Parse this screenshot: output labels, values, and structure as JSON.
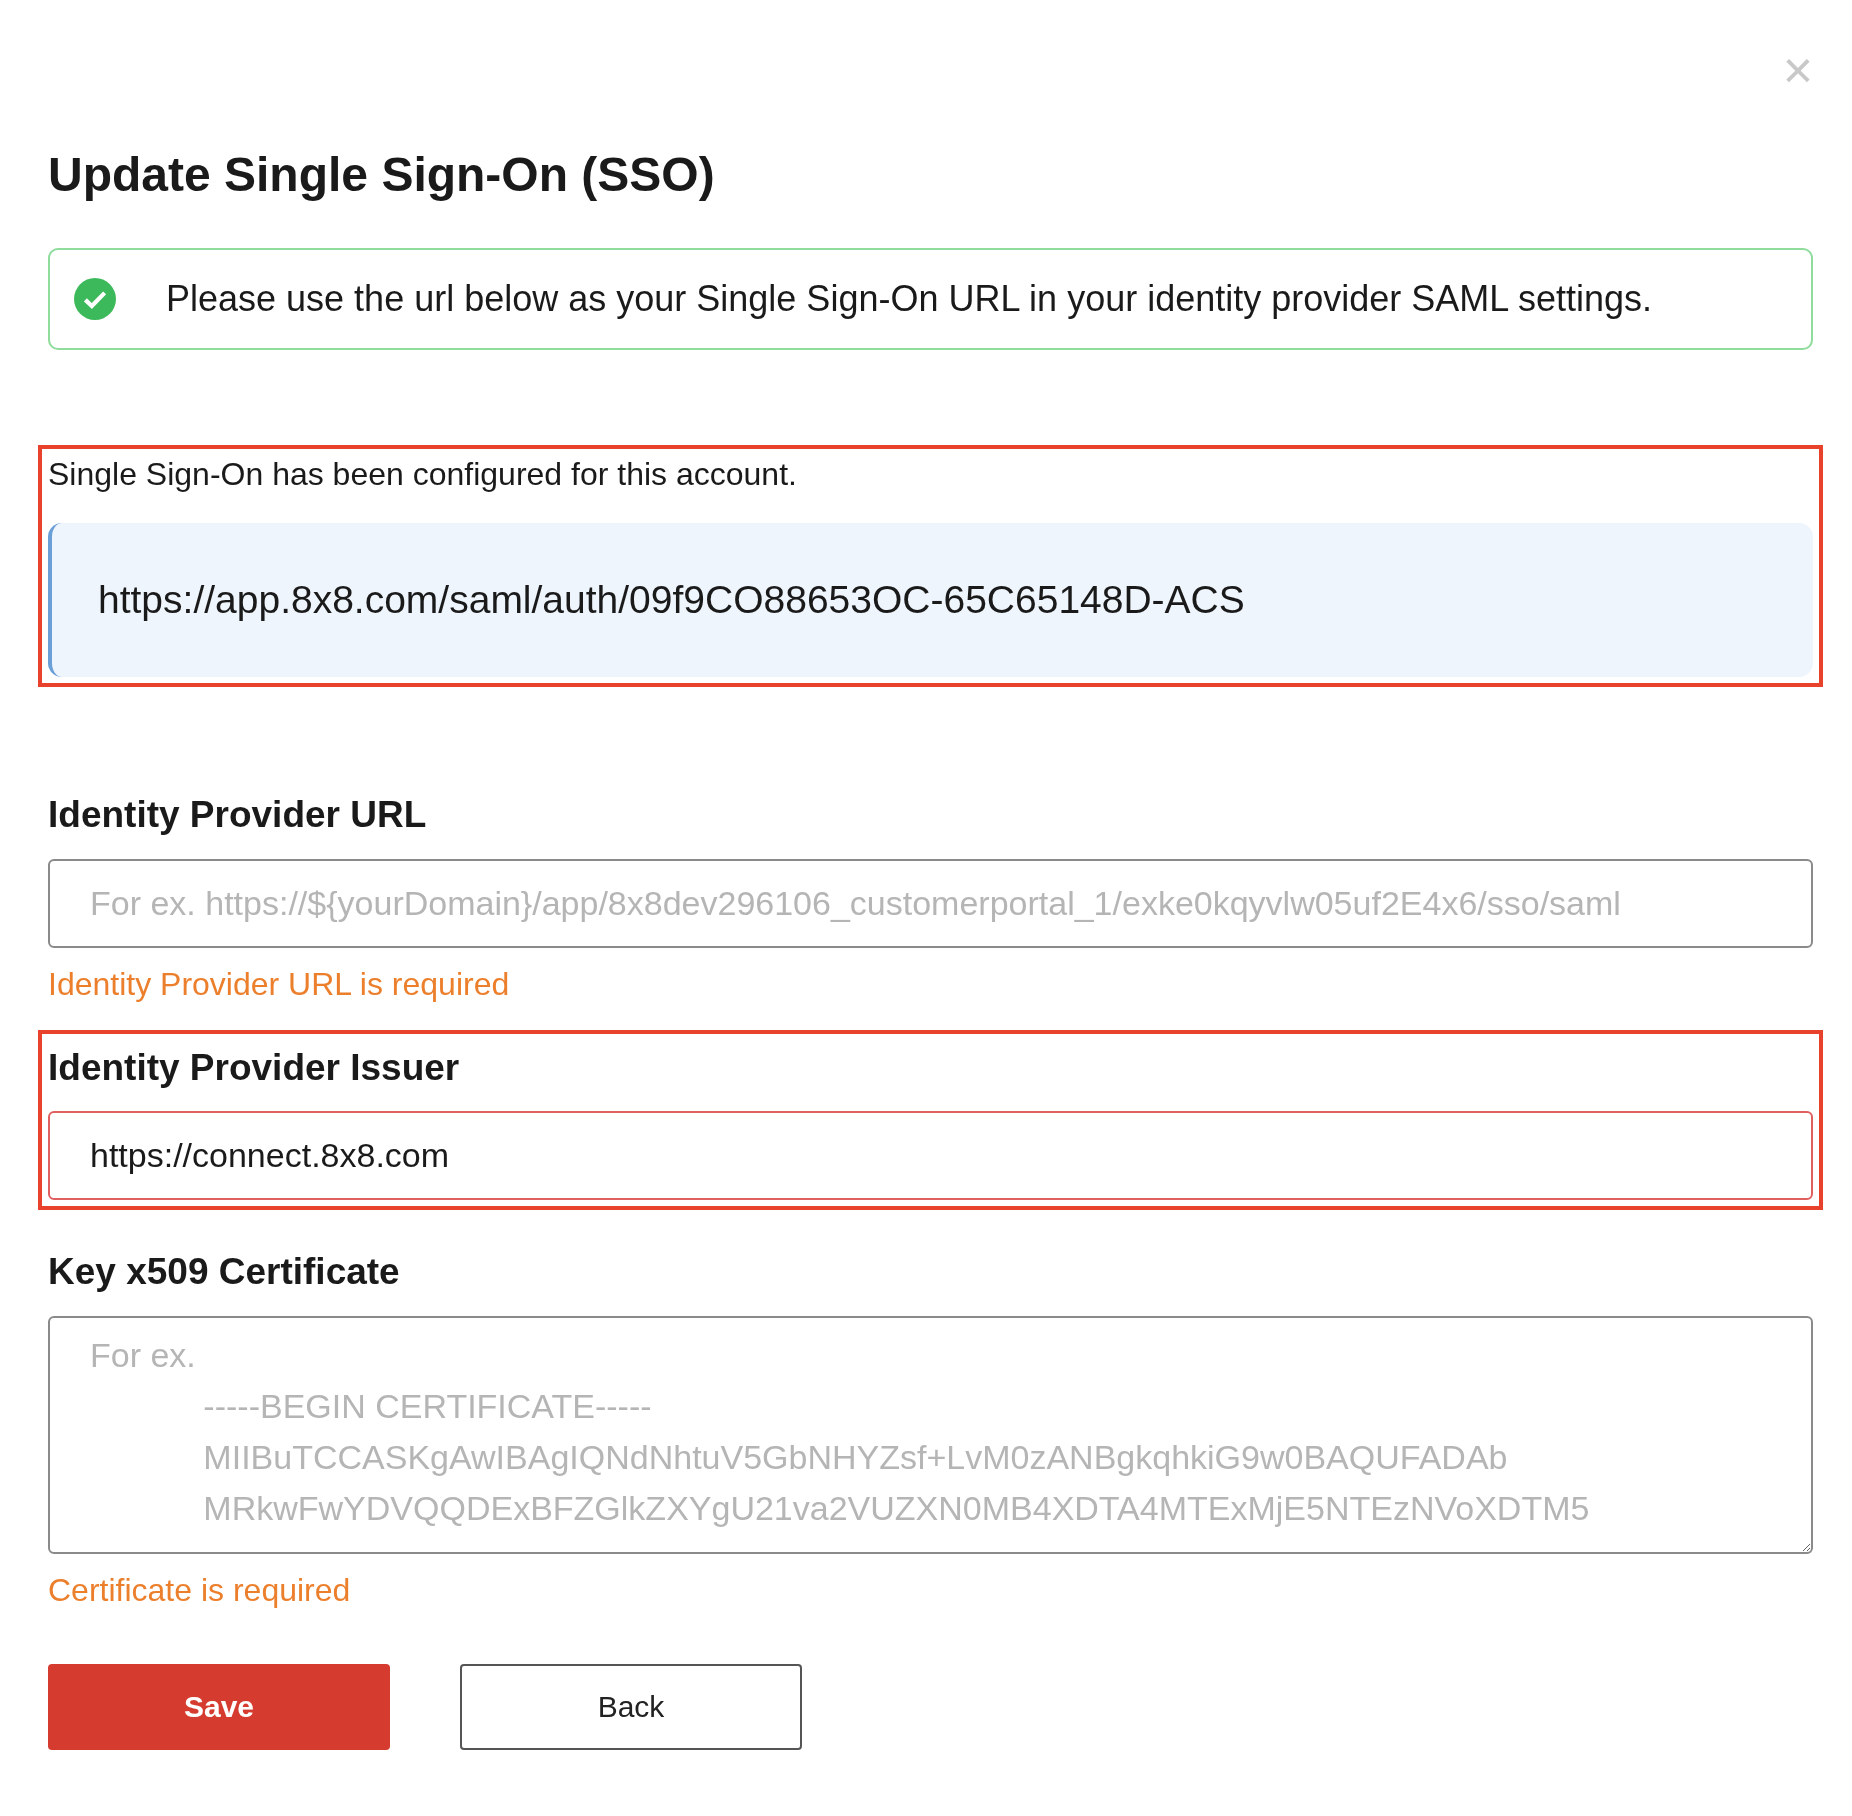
{
  "dialog": {
    "title": "Update Single Sign-On (SSO)",
    "close": "×"
  },
  "alert": {
    "kind": "success",
    "message": "Please use the url below as your Single Sign-On URL in your identity provider SAML settings."
  },
  "sso_info": {
    "highlighted": true,
    "message": "Single Sign-On has been configured for this account.",
    "url": "https://app.8x8.com/saml/auth/09f9CO88653OC-65C65148D-ACS"
  },
  "fields": [
    {
      "kind": "input",
      "label": "Identity Provider URL",
      "placeholder": "For ex. https://${yourDomain}/app/8x8dev296106_customerportal_1/exke0kqyvlw05uf2E4x6/sso/saml",
      "error": "Identity Provider URL is required",
      "highlighted": false
    },
    {
      "kind": "input",
      "label": "Identity Provider Issuer",
      "value": "https://connect.8x8.com",
      "highlighted": true
    },
    {
      "kind": "textarea",
      "label": "Key x509 Certificate",
      "placeholder": "For ex.\n\t\t-----BEGIN CERTIFICATE-----\n\t\tMIIBuTCCASKgAwIBAgIQNdNhtuV5GbNHYZsf+LvM0zANBgkqhkiG9w0BAQUFADAb\n\t\tMRkwFwYDVQQDExBFZGlkZXYgU21va2VUZXN0MB4XDTA4MTExMjE5NTEzNVoXDTM5",
      "error": "Certificate is required",
      "highlighted": false
    }
  ],
  "buttons": [
    {
      "kind": "primary",
      "label": "Save"
    },
    {
      "kind": "secondary",
      "label": "Back"
    }
  ]
}
